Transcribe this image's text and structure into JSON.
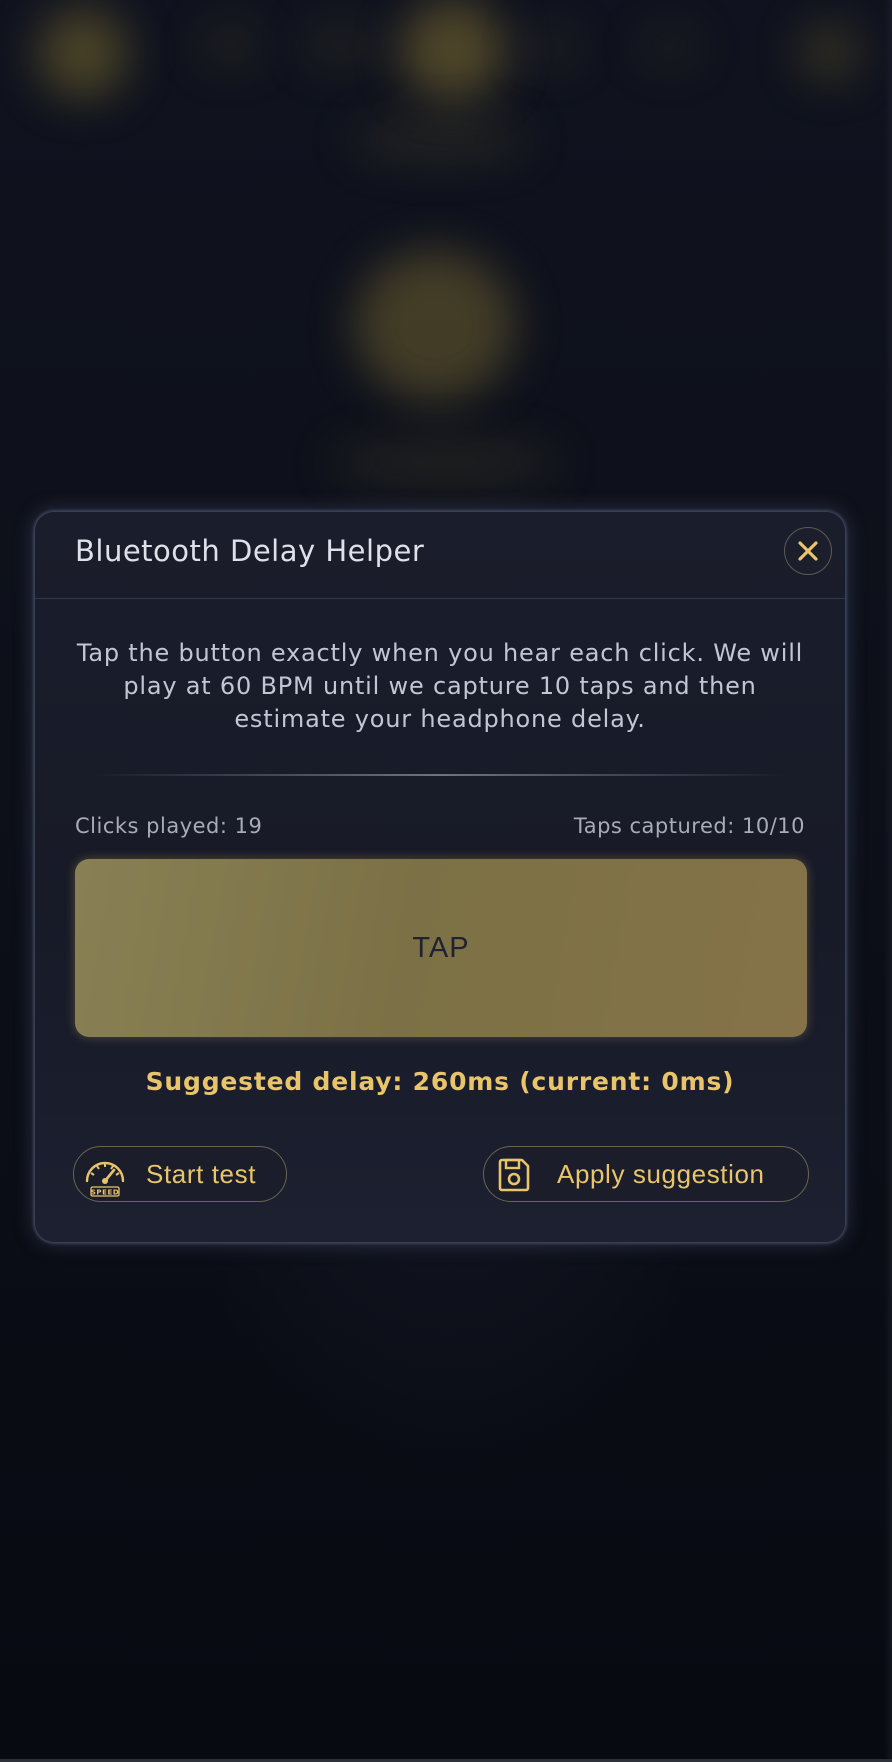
{
  "modal": {
    "title": "Bluetooth Delay Helper",
    "description": "Tap the button exactly when you hear each click. We will play at 60 BPM until we capture 10 taps and then estimate your headphone delay.",
    "clicks_played": "Clicks played: 19",
    "taps_captured": "Taps captured: 10/10",
    "tap_label": "TAP",
    "suggestion": "Suggested delay: 260ms (current: 0ms)",
    "start_label": "Start test",
    "apply_label": "Apply suggestion",
    "speed_icon_text": "SPEED"
  },
  "colors": {
    "accent": "#e9c46a",
    "modal_bg": "#1a1d2b",
    "tap_button": "#7c7146",
    "page_bg": "#0b0d16"
  },
  "icons": {
    "close": "close-icon",
    "start": "speedometer-icon",
    "apply": "save-icon"
  }
}
